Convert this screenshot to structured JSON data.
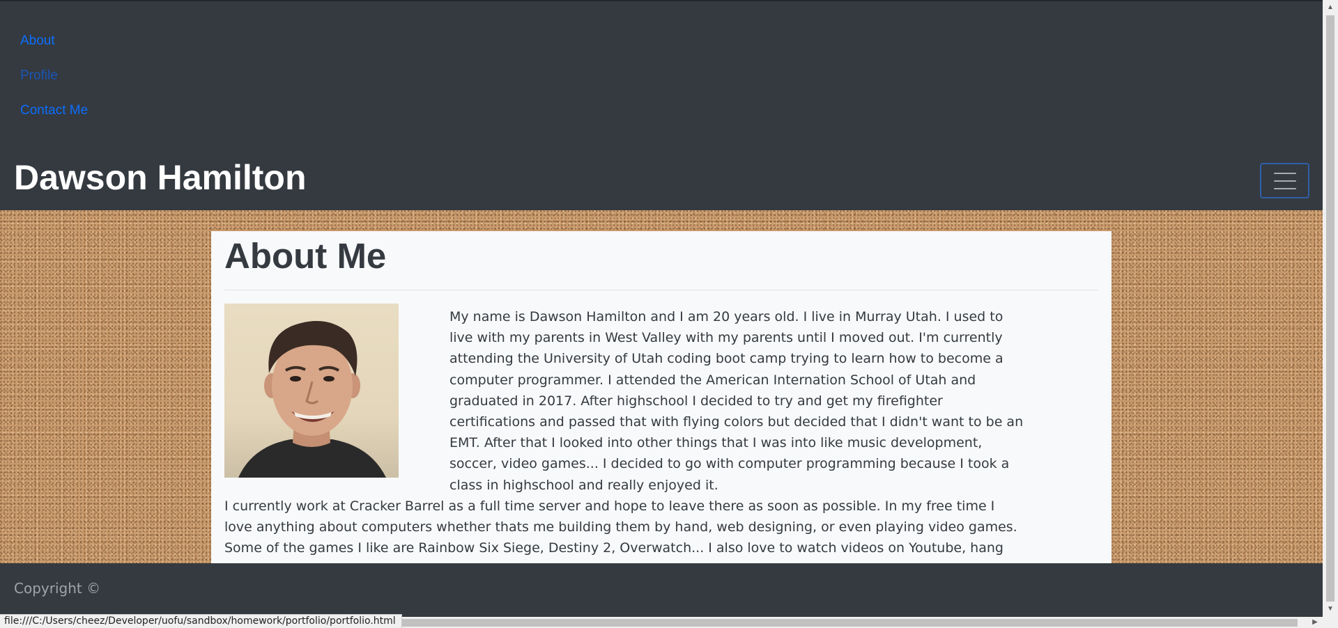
{
  "navbar": {
    "links": [
      "About",
      "Profile",
      "Contact Me"
    ],
    "brand": "Dawson Hamilton",
    "toggler_icon": "hamburger-menu-icon"
  },
  "about": {
    "title": "About Me",
    "photo": "portrait-photo",
    "paragraph1": "My name is Dawson Hamilton and I am 20 years old. I live in Murray Utah. I used to live with my parents in West Valley with my parents until I moved out. I'm currently attending the University of Utah coding boot camp trying to learn how to become a computer programmer. I attended the American Internation School of Utah and graduated in 2017. After highschool I decided to try and get my firefighter certifications and passed that with flying colors but decided that I didn't want to be an EMT. After that I looked into other things that I was into like music development, soccer, video games... I decided to go with computer programming because I took a class in highschool and really enjoyed it.",
    "paragraph2": "I currently work at Cracker Barrel as a full time server and hope to leave there as soon as possible. In my free time I love anything about computers whether thats me building them by hand, web designing, or even playing video games. Some of the games I like are Rainbow Six Siege, Destiny 2, Overwatch... I also love to watch videos on Youtube, hang out with my freinds from high school, and play lots and lots of DnD. My end goal is to become a video game designer some day but being a web developer is a really"
  },
  "footer": {
    "copyright": "Copyright ©"
  },
  "browser": {
    "status_url": "file:///C:/Users/cheez/Developer/uofu/sandbox/homework/portfolio/portfolio.html"
  },
  "colors": {
    "navbar_bg": "#343a40",
    "link": "#0d6efd",
    "card_bg": "#f8f9fa",
    "cork": "#c99a6c"
  }
}
